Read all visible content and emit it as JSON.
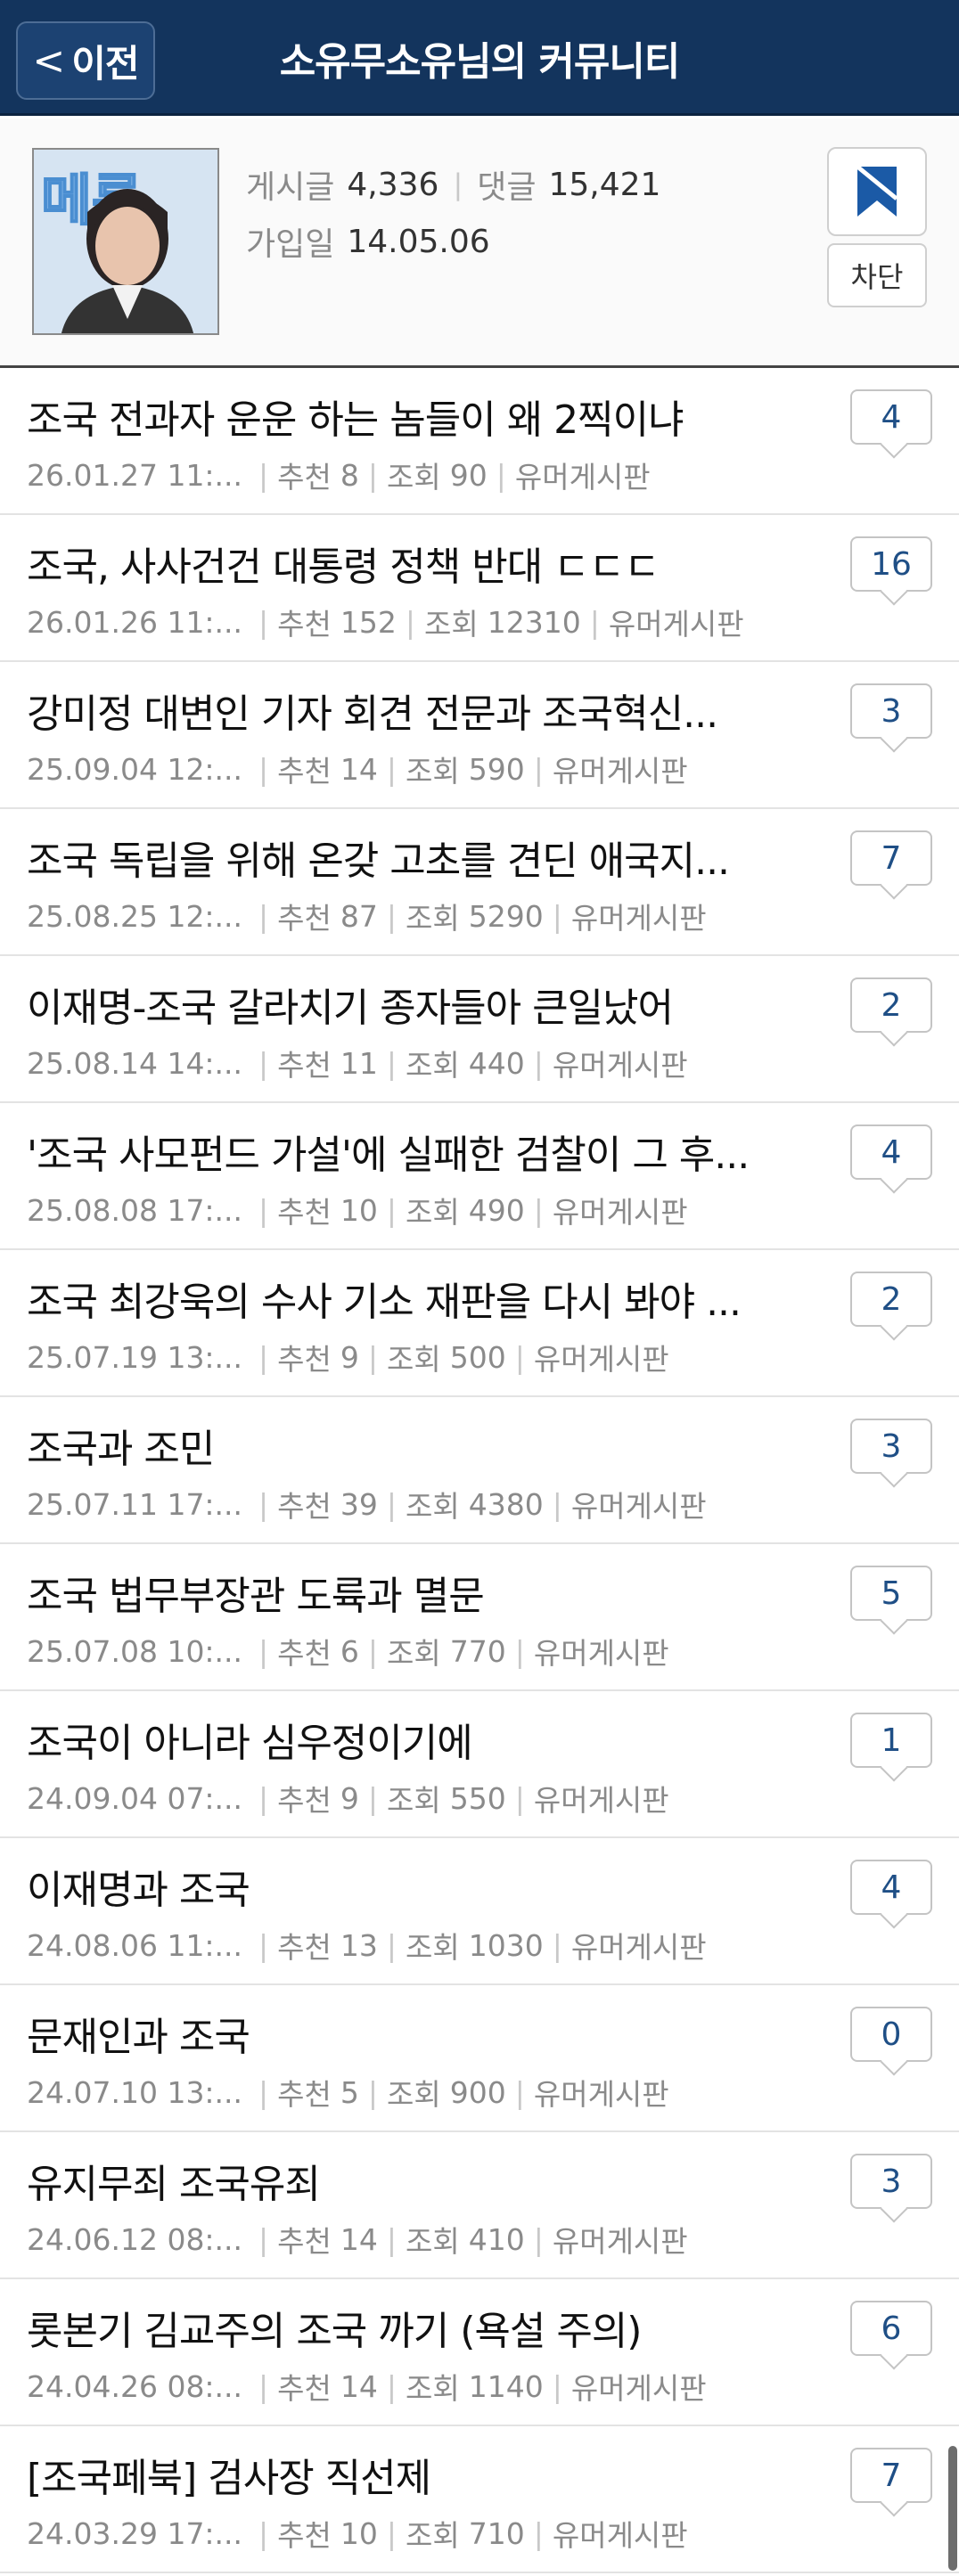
{
  "header": {
    "back_label": "이전",
    "title": "소유무소유님의 커뮤니티"
  },
  "profile": {
    "avatar_text": "메롱",
    "posts_label": "게시글",
    "posts_value": "4,336",
    "comments_label": "댓글",
    "comments_value": "15,421",
    "joined_label": "가입일",
    "joined_value": "14.05.06",
    "block_label": "차단"
  },
  "colors": {
    "header_bg": "#13345d",
    "comment_count": "#1f4f86",
    "bookmark_icon": "#1b5aa6"
  },
  "posts": [
    {
      "title": "조국 전과자 운운 하는 놈들이 왜 2찍이냐",
      "date": "26.01.27 11:...",
      "rec_label": "추천",
      "rec": "8",
      "views_label": "조회",
      "views": "90",
      "board": "유머게시판",
      "comments": "4"
    },
    {
      "title": "조국, 사사건건 대통령 정책 반대 ㄷㄷㄷ",
      "date": "26.01.26 11:...",
      "rec_label": "추천",
      "rec": "152",
      "views_label": "조회",
      "views": "12310",
      "board": "유머게시판",
      "comments": "16"
    },
    {
      "title": "강미정 대변인 기자 회견 전문과 조국혁신...",
      "date": "25.09.04 12:...",
      "rec_label": "추천",
      "rec": "14",
      "views_label": "조회",
      "views": "590",
      "board": "유머게시판",
      "comments": "3"
    },
    {
      "title": "조국 독립을 위해 온갖 고초를 견딘 애국지...",
      "date": "25.08.25 12:...",
      "rec_label": "추천",
      "rec": "87",
      "views_label": "조회",
      "views": "5290",
      "board": "유머게시판",
      "comments": "7"
    },
    {
      "title": "이재명-조국 갈라치기 종자들아 큰일났어",
      "date": "25.08.14 14:...",
      "rec_label": "추천",
      "rec": "11",
      "views_label": "조회",
      "views": "440",
      "board": "유머게시판",
      "comments": "2"
    },
    {
      "title": "'조국 사모펀드 가설'에 실패한 검찰이 그 후...",
      "date": "25.08.08 17:...",
      "rec_label": "추천",
      "rec": "10",
      "views_label": "조회",
      "views": "490",
      "board": "유머게시판",
      "comments": "4"
    },
    {
      "title": "조국 최강욱의 수사 기소 재판을 다시 봐야 ...",
      "date": "25.07.19 13:...",
      "rec_label": "추천",
      "rec": "9",
      "views_label": "조회",
      "views": "500",
      "board": "유머게시판",
      "comments": "2"
    },
    {
      "title": "조국과 조민",
      "date": "25.07.11 17:...",
      "rec_label": "추천",
      "rec": "39",
      "views_label": "조회",
      "views": "4380",
      "board": "유머게시판",
      "comments": "3"
    },
    {
      "title": "조국 법무부장관 도륙과 멸문",
      "date": "25.07.08 10:...",
      "rec_label": "추천",
      "rec": "6",
      "views_label": "조회",
      "views": "770",
      "board": "유머게시판",
      "comments": "5"
    },
    {
      "title": "조국이 아니라 심우정이기에",
      "date": "24.09.04 07:...",
      "rec_label": "추천",
      "rec": "9",
      "views_label": "조회",
      "views": "550",
      "board": "유머게시판",
      "comments": "1"
    },
    {
      "title": "이재명과 조국",
      "date": "24.08.06 11:...",
      "rec_label": "추천",
      "rec": "13",
      "views_label": "조회",
      "views": "1030",
      "board": "유머게시판",
      "comments": "4"
    },
    {
      "title": "문재인과 조국",
      "date": "24.07.10 13:...",
      "rec_label": "추천",
      "rec": "5",
      "views_label": "조회",
      "views": "900",
      "board": "유머게시판",
      "comments": "0"
    },
    {
      "title": "유지무죄 조국유죄",
      "date": "24.06.12 08:...",
      "rec_label": "추천",
      "rec": "14",
      "views_label": "조회",
      "views": "410",
      "board": "유머게시판",
      "comments": "3"
    },
    {
      "title": "롯본기 김교주의 조국 까기 (욕설 주의)",
      "date": "24.04.26 08:...",
      "rec_label": "추천",
      "rec": "14",
      "views_label": "조회",
      "views": "1140",
      "board": "유머게시판",
      "comments": "6"
    },
    {
      "title": "[조국페북] 검사장 직선제",
      "date": "24.03.29 17:...",
      "rec_label": "추천",
      "rec": "10",
      "views_label": "조회",
      "views": "710",
      "board": "유머게시판",
      "comments": "7"
    }
  ]
}
